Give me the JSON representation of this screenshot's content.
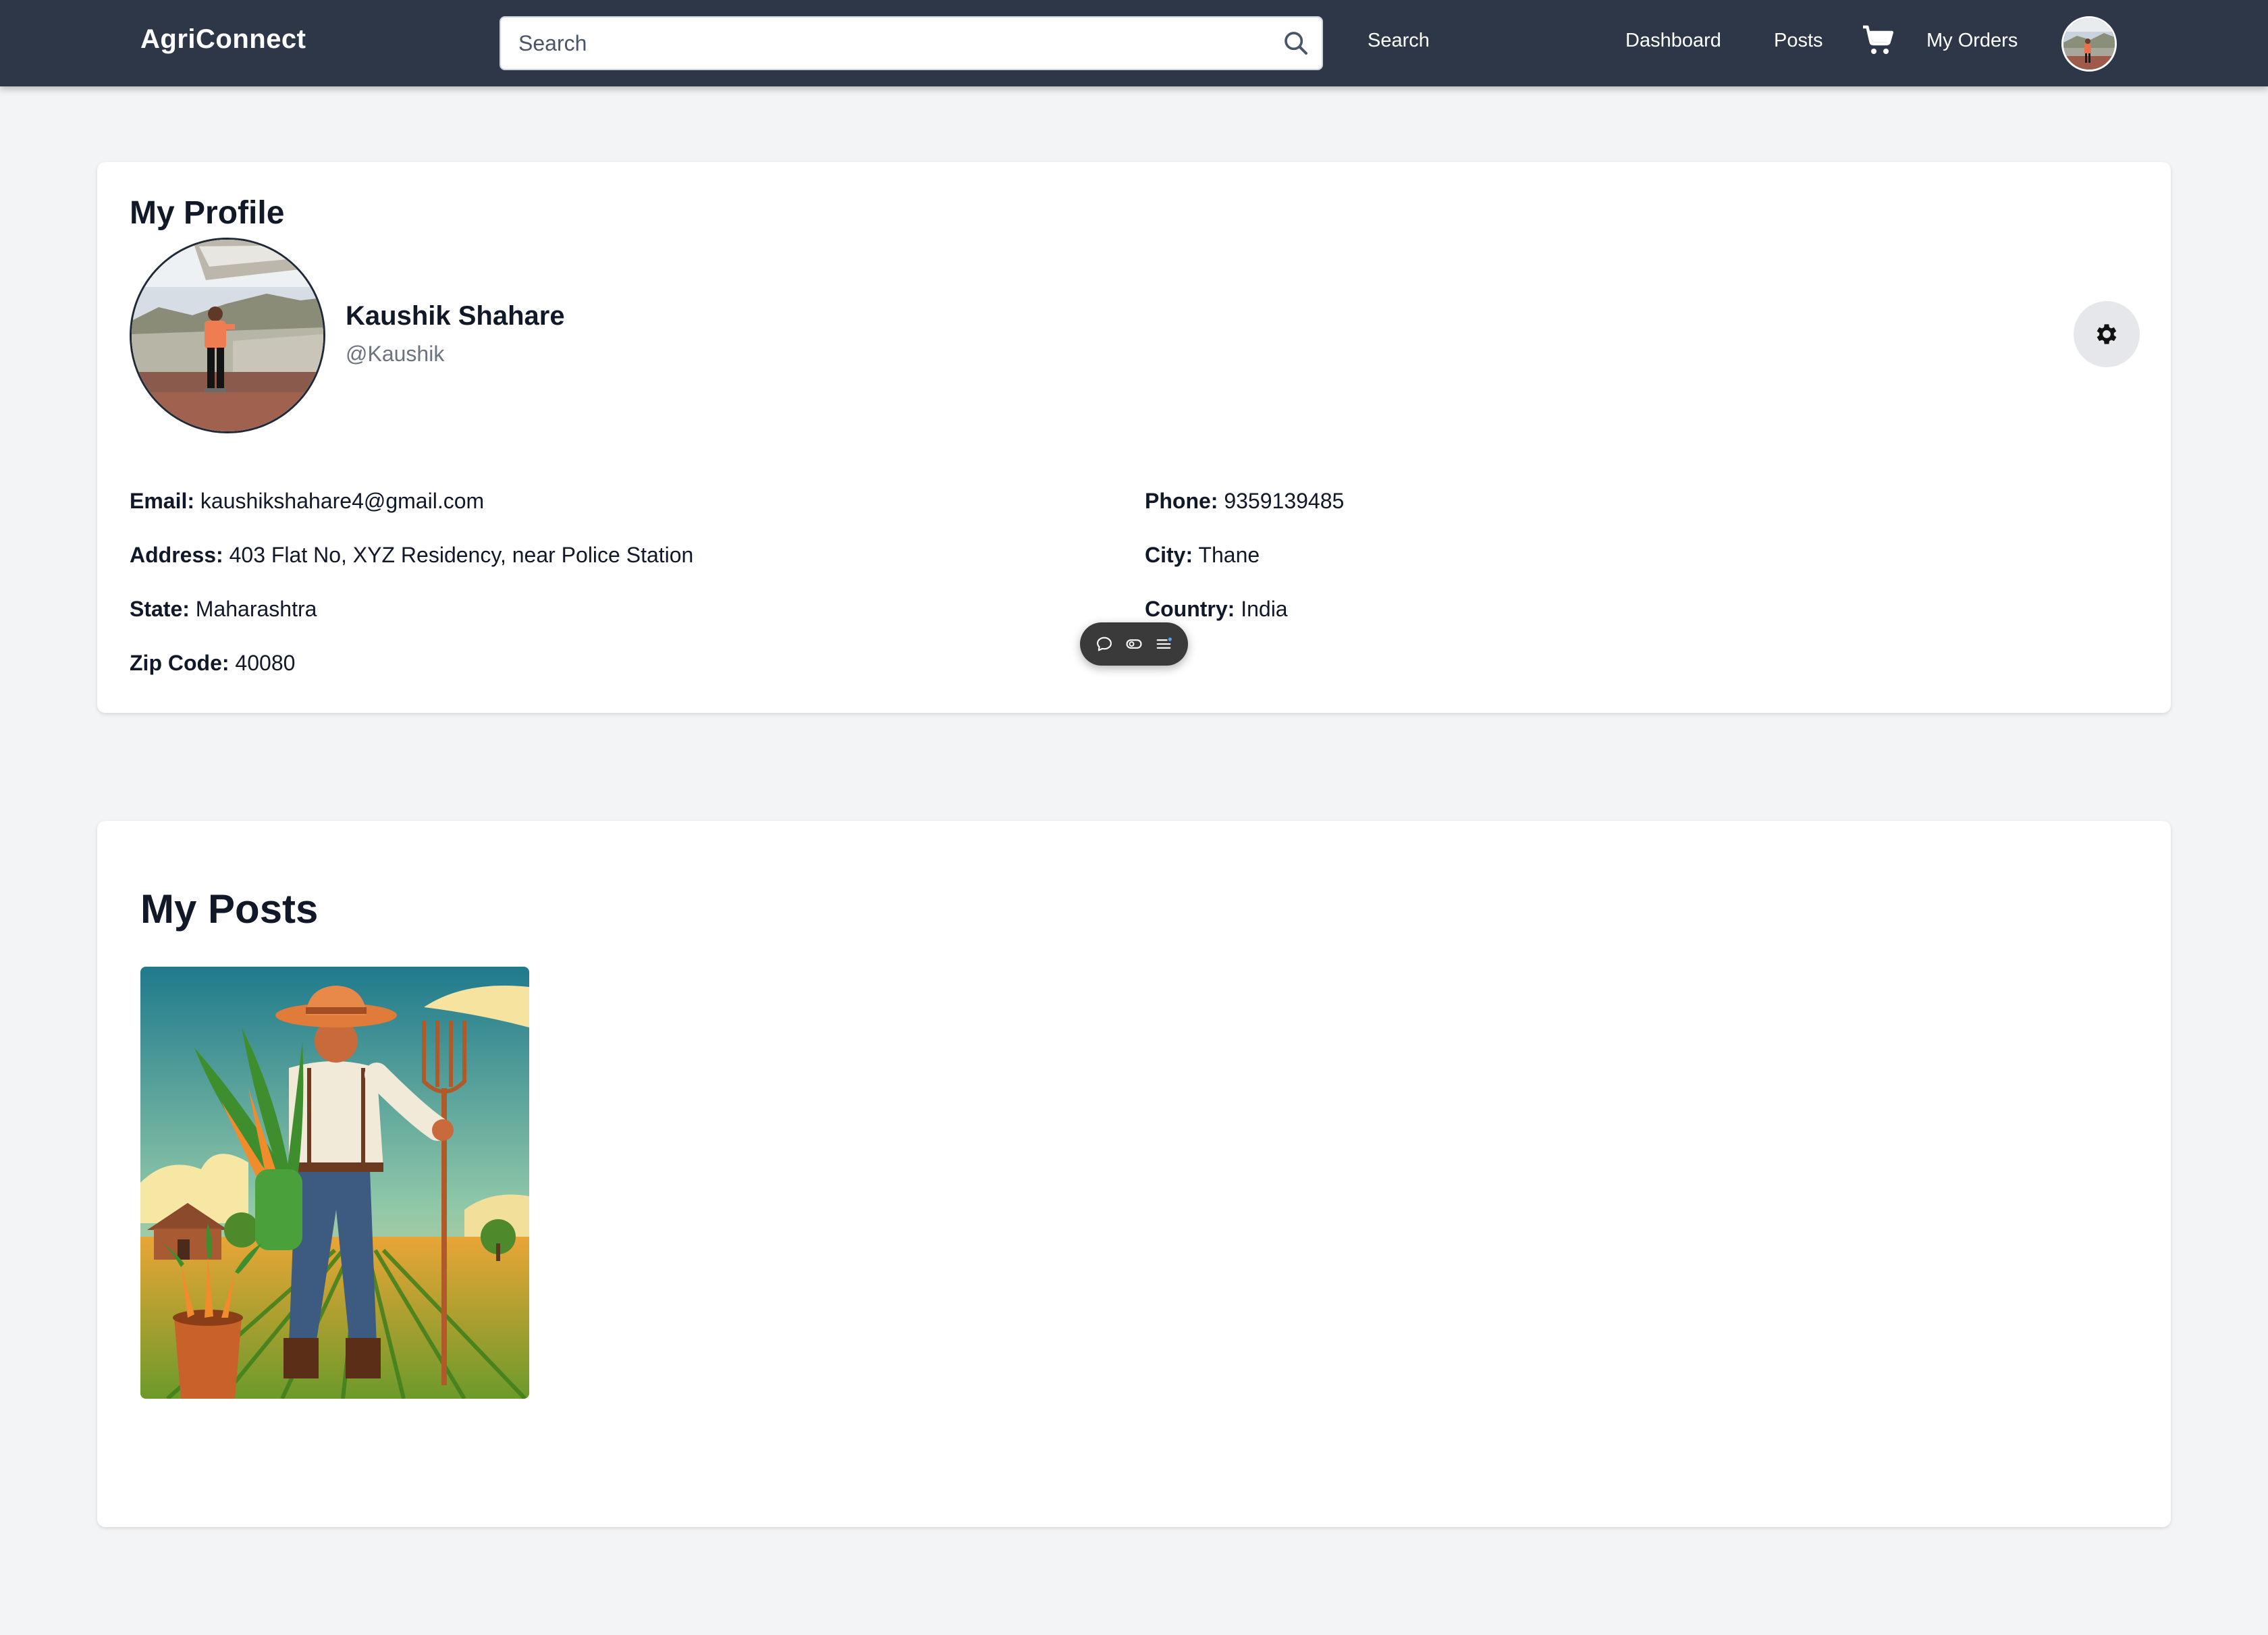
{
  "navbar": {
    "brand": "AgriConnect",
    "search_placeholder": "Search",
    "search_button": "Search",
    "links": [
      "Dashboard",
      "Posts",
      "My Orders"
    ],
    "cart_icon": "cart-icon",
    "avatar_icon": "user-avatar"
  },
  "profile": {
    "title": "My Profile",
    "name": "Kaushik Shahare",
    "handle": "@Kaushik",
    "settings_icon": "gear-icon",
    "fields": {
      "email": {
        "label": "Email:",
        "value": "kaushikshahare4@gmail.com"
      },
      "phone": {
        "label": "Phone:",
        "value": "9359139485"
      },
      "address": {
        "label": "Address:",
        "value": "403 Flat No, XYZ Residency, near Police Station"
      },
      "city": {
        "label": "City:",
        "value": "Thane"
      },
      "state": {
        "label": "State:",
        "value": "Maharashtra"
      },
      "country": {
        "label": "Country:",
        "value": "India"
      },
      "zip": {
        "label": "Zip Code:",
        "value": "40080"
      }
    }
  },
  "floating_toolbar": {
    "icons": [
      "comment-icon",
      "toggle-icon",
      "menu-icon"
    ]
  },
  "posts": {
    "title": "My Posts",
    "items": [
      {
        "image": "farmer-illustration"
      }
    ]
  },
  "colors": {
    "navbar_bg": "#2d3748",
    "page_bg": "#f3f4f6",
    "card_bg": "#ffffff",
    "muted_text": "#6b7280"
  }
}
